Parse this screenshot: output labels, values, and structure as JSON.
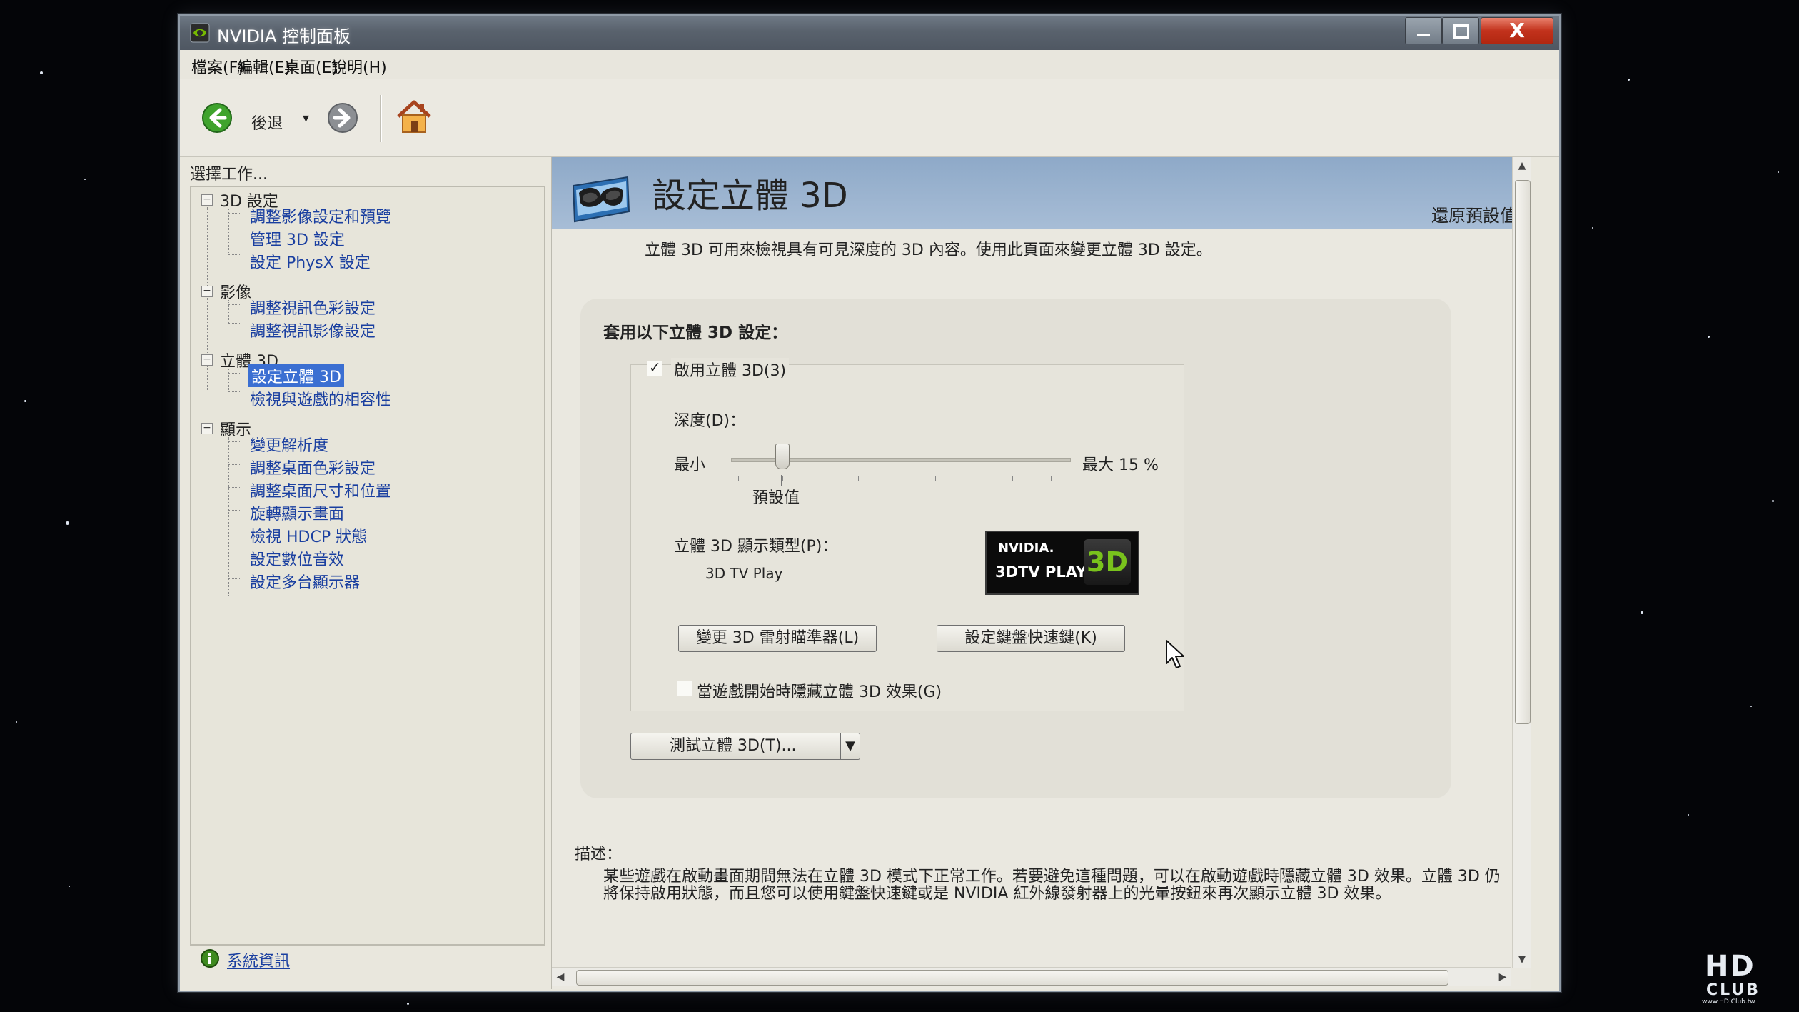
{
  "window": {
    "title": "NVIDIA 控制面板",
    "close_glyph": "X"
  },
  "menu": [
    "檔案(F)",
    "編輯(E)",
    "桌面(E)",
    "說明(H)"
  ],
  "toolbar": {
    "back_label": "後退",
    "dropdown_glyph": "▾"
  },
  "left": {
    "task_label": "選擇工作...",
    "tree": [
      {
        "label": "3D 設定",
        "toggle": "−",
        "children": [
          "調整影像設定和預覽",
          "管理 3D 設定",
          "設定 PhysX 設定"
        ]
      },
      {
        "label": "影像",
        "toggle": "−",
        "children": [
          "調整視訊色彩設定",
          "調整視訊影像設定"
        ]
      },
      {
        "label": "立體 3D",
        "toggle": "−",
        "children": [
          "設定立體 3D",
          "檢視與遊戲的相容性"
        ],
        "selected_index": 0
      },
      {
        "label": "顯示",
        "toggle": "−",
        "children": [
          "變更解析度",
          "調整桌面色彩設定",
          "調整桌面尺寸和位置",
          "旋轉顯示畫面",
          "檢視 HDCP 狀態",
          "設定數位音效",
          "設定多台顯示器"
        ]
      }
    ],
    "sysinfo_link": "系統資訊"
  },
  "page": {
    "title": "設定立體 3D",
    "restore_defaults": "還原預設值",
    "intro": "立體 3D 可用來檢視具有可見深度的 3D 內容。使用此頁面來變更立體 3D 設定。",
    "apply_title": "套用以下立體 3D 設定：",
    "enable_label": "啟用立體 3D(3)",
    "enable_checked": true,
    "depth_label": "深度(D)：",
    "min_label": "最小",
    "max_label": "最大 15 %",
    "default_label": "預設值",
    "depth_value_fraction": 0.15,
    "display_type_label": "立體 3D 顯示類型(P)：",
    "display_type_value": "3D TV Play",
    "logo": {
      "brand": "NVIDIA.",
      "product": "3DTV PLAY",
      "badge": "3D"
    },
    "laser_button": "變更 3D 雷射瞄準器(L)",
    "hotkey_button": "設定鍵盤快速鍵(K)",
    "hide_label": "當遊戲開始時隱藏立體 3D 效果(G)",
    "hide_checked": false,
    "test_button": "測試立體 3D(T)...",
    "test_arrow": "▼",
    "desc_label": "描述：",
    "description": "某些遊戲在啟動畫面期間無法在立體 3D 模式下正常工作。若要避免這種問題，可以在啟動遊戲時隱藏立體 3D 效果。立體 3D 仍將保持啟用狀態，而且您可以使用鍵盤快速鍵或是 NVIDIA 紅外線發射器上的光暈按鈕來再次顯示立體 3D 效果。"
  },
  "scroll": {
    "up": "▲",
    "down": "▼",
    "left": "◀",
    "right": "▶"
  },
  "watermark": {
    "big": "HD",
    "small": "CLUB",
    "url": "www.HD.Club.tw"
  },
  "icons": {
    "app": "nvidia-app-icon",
    "back": "back-arrow-icon",
    "forward": "forward-arrow-icon",
    "home": "home-icon",
    "glasses": "3d-glasses-icon",
    "sysinfo": "system-info-icon",
    "cursor": "mouse-cursor-icon"
  },
  "colors": {
    "header_band": "#a7bdd6",
    "selection": "#3b6fd2",
    "link": "#1a3fa0",
    "nvidia_green": "#79c21c",
    "close_button": "#c2321c"
  }
}
